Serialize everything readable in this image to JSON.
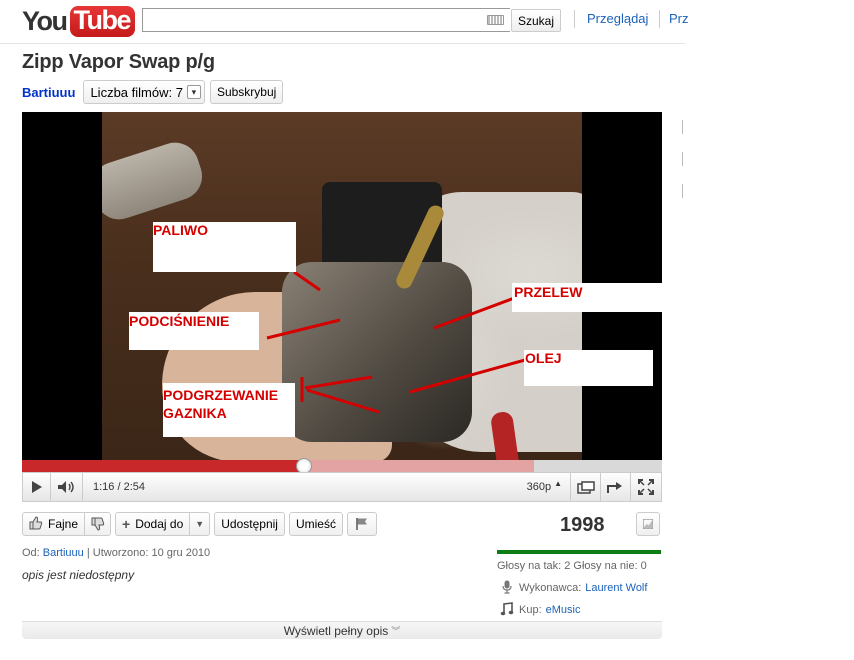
{
  "header": {
    "logo_you": "You",
    "logo_tube": "Tube",
    "search_value": "",
    "search_button": "Szukaj",
    "nav": [
      "Przeglądaj",
      "Prz"
    ]
  },
  "video": {
    "title": "Zipp Vapor Swap p/g",
    "owner": "Bartiuuu",
    "films_label": "Liczba filmów: 7",
    "subscribe": "Subskrybuj"
  },
  "annotations": {
    "paliwo": "PALIWO",
    "podcisnienie": "PODCIŚNIENIE",
    "podgrzewanie": "PODGRZEWANIE",
    "gaznika": "GAZNIKA",
    "przelew": "PRZELEW",
    "olej": "OLEJ"
  },
  "player": {
    "time": "1:16 / 2:54",
    "quality": "360p",
    "played_fraction": 0.44,
    "loaded_fraction": 0.8
  },
  "actions": {
    "like": "Fajne",
    "add": "Dodaj do",
    "share": "Udostępnij",
    "embed": "Umieść"
  },
  "views": "1998",
  "meta": {
    "from_label": "Od:",
    "author": "Bartiuuu",
    "separator": "|",
    "created": "Utworzono: 10 gru 2010"
  },
  "description": "opis jest niedostępny",
  "ratings": {
    "text": "Głosy na tak: 2 Głosy na nie: 0",
    "likes": 2,
    "dislikes": 0
  },
  "credits": {
    "artist_label": "Wykonawca:",
    "artist": "Laurent Wolf",
    "buy_label": "Kup:",
    "buy": "eMusic"
  },
  "expand_label": "Wyświetl pełny opis",
  "colors": {
    "brand_red": "#cc181e",
    "link_blue": "#1c62b9",
    "owner_blue": "#0033cc",
    "annotation_red": "#d40000",
    "rating_green": "#0b7d13"
  }
}
